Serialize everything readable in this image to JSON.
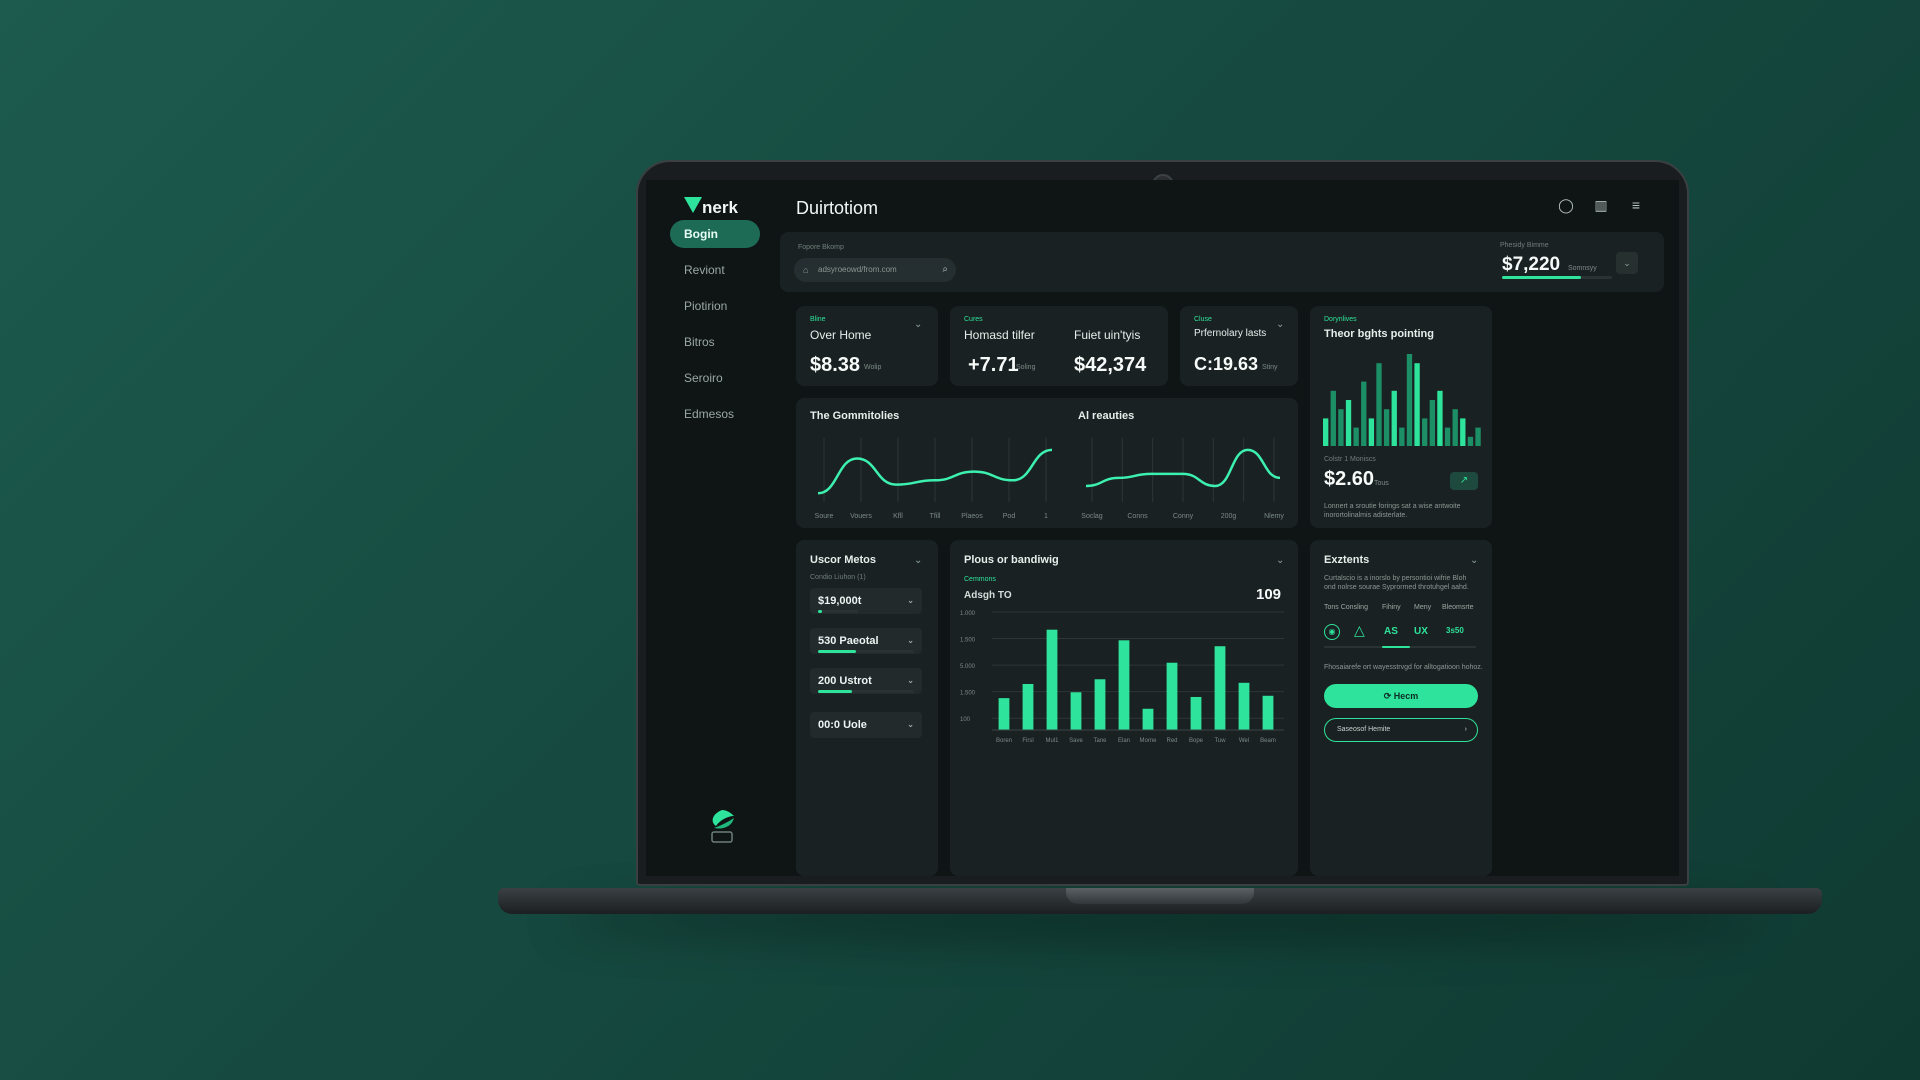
{
  "app": {
    "logo": "nerk",
    "title": "Duirtotiom"
  },
  "sidebar": {
    "items": [
      {
        "label": "Bogin",
        "active": true
      },
      {
        "label": "Reviont"
      },
      {
        "label": "Piotirion"
      },
      {
        "label": "Bitros"
      },
      {
        "label": "Seroiro"
      },
      {
        "label": "Edmesos"
      }
    ]
  },
  "topbar": {
    "label": "Fopore Bkomp",
    "search_value": "adsyroeowd/from.com",
    "right_label": "Phesidy Bimme",
    "right_value": "$7,220",
    "right_unit": "Somnsyy",
    "right_progress": 0.72
  },
  "stats": [
    {
      "tag": "Bline",
      "title": "Over Home",
      "value": "$8.38",
      "unit": "Wolip"
    },
    {
      "tag": "Cures",
      "title": "Homasd tilfer",
      "value": "+7.71",
      "unit": "Soling"
    },
    {
      "tag": "",
      "title": "Fuiet uin'tyis",
      "value": "$42,374",
      "unit": ""
    },
    {
      "tag": "Cluse",
      "title": "Prfernolary lasts",
      "value": "C:19.63",
      "unit": "Stiny"
    }
  ],
  "right_panel": {
    "tag": "Dorynlives",
    "title": "Theor bghts pointing",
    "sub": "Colstr 1 Moniscs",
    "value": "$2.60",
    "unit": "Tous",
    "desc": "Lonnert a sroutie forings sat a wise antwoite inorortolinalmis adisterlate."
  },
  "line_charts": [
    {
      "title": "The Gommitolies",
      "ticks": [
        "Soure",
        "Vouers",
        "Kfll",
        "Tfill",
        "Plaeos",
        "Pod",
        "1"
      ]
    },
    {
      "title": "Al reauties",
      "ticks": [
        "Soclag",
        "Conns",
        "Conny",
        "200g",
        "Nlemy"
      ]
    }
  ],
  "user_metrics": {
    "title": "Uscor Metos",
    "sub": "Condio Liuhon (1)",
    "items": [
      {
        "label": "$19,000t",
        "progress": 0.02
      },
      {
        "label": "530 Paeotal",
        "progress": 0.4
      },
      {
        "label": "200 Ustrot",
        "progress": 0.3
      },
      {
        "label": "00:0 Uole",
        "progress": 0
      }
    ]
  },
  "bar_panel": {
    "title": "Plous or bandiwig",
    "sub": "Cemmons",
    "left_label": "Adsgh TO",
    "right_value": "109",
    "y_ticks": [
      "1.000",
      "1.500",
      "5.000",
      "1.500",
      "100"
    ],
    "x_ticks": [
      "Boren",
      "Firsl",
      "Mul1",
      "Save",
      "Tane",
      "Elan",
      "Morne",
      "Red",
      "Bope",
      "Tuw",
      "Wel",
      "Beam"
    ]
  },
  "extents": {
    "title": "Exztents",
    "desc": "Curtalscio is a inorslo by persontioi wifrie Bloh ond nolrse sourae Syprormed throtuhgel aahd.",
    "tabs": [
      "Tons Consling",
      "Fihiny",
      "Meny",
      "Bleomsrte"
    ],
    "chips": [
      "AS",
      "UX",
      "3s50"
    ],
    "note": "Fhosaiarefe ort wayesstrvgd for alltogatioon hohoz.",
    "primary": "Hecm",
    "secondary": "Saseosof Hemite"
  },
  "chart_data": [
    {
      "type": "line",
      "title": "The Gommitolies",
      "x": [
        "Soure",
        "Vouers",
        "Kfll",
        "Tfill",
        "Plaeos",
        "Pod",
        "1"
      ],
      "series": [
        {
          "values": [
            1,
            5,
            2,
            2.5,
            3.5,
            2.5,
            6
          ]
        }
      ]
    },
    {
      "type": "line",
      "title": "Al reauties",
      "x": [
        "Soclag",
        "Conns",
        "Conny",
        "200g",
        "Nlemy"
      ],
      "series": [
        {
          "values": [
            2,
            3,
            3.5,
            3.5,
            2,
            6.5,
            3
          ]
        }
      ]
    },
    {
      "type": "bar",
      "title": "Plous or bandiwig",
      "categories": [
        "Boren",
        "Firsl",
        "Mul1",
        "Save",
        "Tane",
        "Elan",
        "Morne",
        "Red",
        "Bope",
        "Tuw",
        "Wel",
        "Beam"
      ],
      "values": [
        2.7,
        3.9,
        8.5,
        3.2,
        4.3,
        7.6,
        1.8,
        5.7,
        2.8,
        7.1,
        4.0,
        2.9
      ],
      "ylim": [
        0,
        10
      ]
    },
    {
      "type": "bar",
      "title": "Theor bghts pointing",
      "values": [
        3,
        6,
        4,
        5,
        2,
        7,
        3,
        9,
        4,
        6,
        2,
        10,
        9,
        3,
        5,
        6,
        2,
        4,
        3,
        1,
        2
      ]
    }
  ],
  "colors": {
    "accent": "#2ee39b",
    "panel": "#1a2122",
    "screen": "#0f1415"
  }
}
